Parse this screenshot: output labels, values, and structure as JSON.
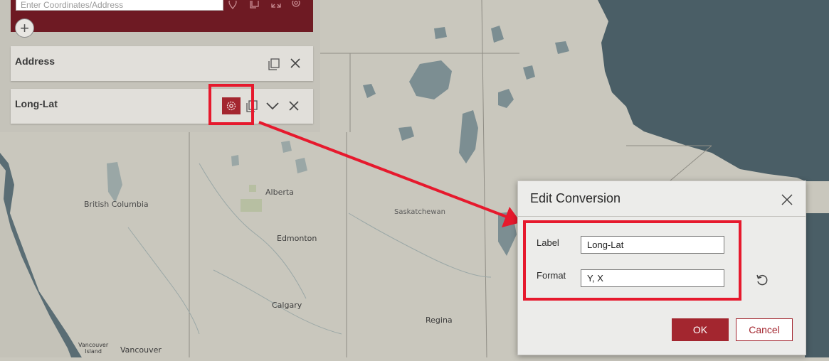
{
  "map": {
    "labels": {
      "alberta": "Alberta",
      "british_columbia": "British Columbia",
      "saskatchewan": "Saskatchewan",
      "edmonton": "Edmonton",
      "calgary": "Calgary",
      "regina": "Regina",
      "vancouver": "Vancouver",
      "vancouver_island_1": "Vancouver",
      "vancouver_island_2": "Island"
    }
  },
  "panel": {
    "coordinate_input": {
      "value": "",
      "placeholder": "Enter Coordinates/Address"
    },
    "toolbar_icons": [
      "map-pin-icon",
      "copy-icon",
      "expand-icon",
      "gear-icon"
    ],
    "add_icon": "plus-icon",
    "conversions": [
      {
        "label": "Address",
        "icons": [
          "copy-icon",
          "close-icon"
        ]
      },
      {
        "label": "Long-Lat",
        "icons": [
          "gear-icon",
          "copy-icon",
          "chevron-down-icon",
          "close-icon"
        ]
      }
    ]
  },
  "dialog": {
    "title": "Edit Conversion",
    "label_field": {
      "label": "Label",
      "value": "Long-Lat"
    },
    "format_field": {
      "label": "Format",
      "value": "Y, X"
    },
    "reset_icon": "reset-icon",
    "ok_label": "OK",
    "cancel_label": "Cancel"
  },
  "colors": {
    "brand": "#a3262f",
    "brand_dark": "#6e1a23",
    "callout": "#e6192d",
    "water": "#4a5e66",
    "land": "#c9c7bd"
  }
}
